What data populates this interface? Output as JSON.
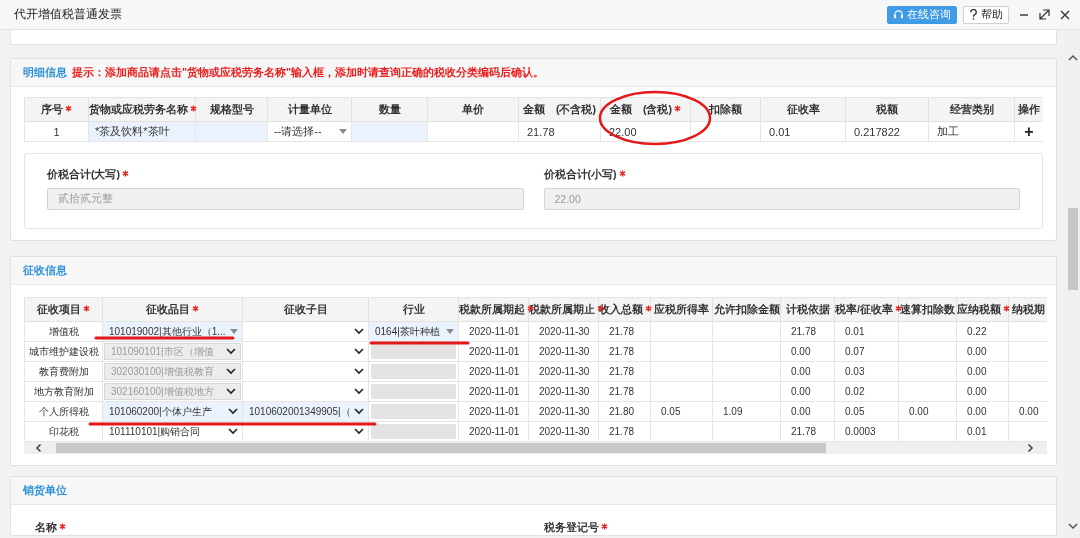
{
  "window": {
    "title": "代开增值税普通发票",
    "buttons": [
      {
        "kind": "consult",
        "label": "在线咨询"
      },
      {
        "kind": "help",
        "label": "帮助"
      }
    ]
  },
  "detail": {
    "title": "明细信息",
    "hint": "提示：添加商品请点击\"货物或应税劳务名称\"输入框，添加时请查询正确的税收分类编码后确认。",
    "table": {
      "columns": [
        {
          "label": "序号",
          "required": true
        },
        {
          "label": "货物或应税劳务名称",
          "required": true
        },
        {
          "label": "规格型号",
          "required": false
        },
        {
          "label": "计量单位",
          "required": false
        },
        {
          "label": "数量",
          "required": false
        },
        {
          "label": "单价",
          "required": false
        },
        {
          "label": "金额　(不含税)",
          "required": false
        },
        {
          "label": "金额　(含税)",
          "required": true
        },
        {
          "label": "扣除额",
          "required": false
        },
        {
          "label": "征收率",
          "required": false
        },
        {
          "label": "税额",
          "required": false
        },
        {
          "label": "经营类别",
          "required": false
        },
        {
          "label": "操作",
          "required": false
        }
      ],
      "rows": [
        {
          "cells": [
            {
              "kind": "text",
              "value": "1"
            },
            {
              "kind": "input",
              "value": "*茶及饮料*茶叶",
              "highlighted": true,
              "disabled": false
            },
            {
              "kind": "input",
              "highlighted": true,
              "disabled": false
            },
            {
              "kind": "combo",
              "value": "--请选择--",
              "highlighted": false,
              "disabled": false
            },
            {
              "kind": "input",
              "highlighted": true,
              "disabled": false
            },
            {
              "kind": "text"
            },
            {
              "kind": "text",
              "value": "21.78"
            },
            {
              "kind": "text",
              "value": "22.00"
            },
            {
              "kind": "text"
            },
            {
              "kind": "text",
              "value": "0.01"
            },
            {
              "kind": "text",
              "value": "0.217822"
            },
            {
              "kind": "text",
              "value": "加工"
            },
            {
              "kind": "action",
              "value": "+"
            }
          ]
        }
      ]
    },
    "totals": [
      {
        "label": "价税合计(大写)",
        "required": true,
        "value": "贰拾贰元整"
      },
      {
        "label": "价税合计(小写)",
        "required": true,
        "value": "22.00"
      }
    ]
  },
  "levy": {
    "title": "征收信息",
    "table": {
      "columns": [
        {
          "label": "征收项目",
          "required": true
        },
        {
          "label": "征收品目",
          "required": true
        },
        {
          "label": "征收子目",
          "required": false
        },
        {
          "label": "行业",
          "required": false
        },
        {
          "label": "税款所属期起",
          "required": true
        },
        {
          "label": "税款所属期止",
          "required": true
        },
        {
          "label": "收入总额",
          "required": true
        },
        {
          "label": "应税所得率",
          "required": false
        },
        {
          "label": "允许扣除金额",
          "required": false
        },
        {
          "label": "计税依据",
          "required": false
        },
        {
          "label": "税率/征收率",
          "required": true
        },
        {
          "label": "速算扣除数",
          "required": false
        },
        {
          "label": "应纳税额",
          "required": true
        },
        {
          "label": "纳税期",
          "required": false
        }
      ],
      "rows": [
        {
          "cells": [
            {
              "kind": "text",
              "value": "增值税"
            },
            {
              "kind": "combo",
              "value": "101019002|其他行业（1...",
              "highlighted": true,
              "disabled": false
            },
            {
              "kind": "select",
              "highlighted": false,
              "disabled": false
            },
            {
              "kind": "combo",
              "value": "0164|茶叶种植",
              "highlighted": true,
              "disabled": false
            },
            {
              "kind": "text",
              "value": "2020-11-01"
            },
            {
              "kind": "text",
              "value": "2020-11-30"
            },
            {
              "kind": "text",
              "value": "21.78"
            },
            {
              "kind": "text"
            },
            {
              "kind": "text"
            },
            {
              "kind": "text",
              "value": "21.78"
            },
            {
              "kind": "text",
              "value": "0.01"
            },
            {
              "kind": "text"
            },
            {
              "kind": "text",
              "value": "0.22"
            },
            {
              "kind": "text"
            }
          ]
        },
        {
          "cells": [
            {
              "kind": "text",
              "value": "城市维护建设税"
            },
            {
              "kind": "select",
              "value": "101090101|市区（增值",
              "highlighted": false,
              "disabled": true
            },
            {
              "kind": "select",
              "highlighted": false,
              "disabled": false
            },
            {
              "kind": "combo",
              "highlighted": false,
              "disabled": true
            },
            {
              "kind": "text",
              "value": "2020-11-01"
            },
            {
              "kind": "text",
              "value": "2020-11-30"
            },
            {
              "kind": "text",
              "value": "21.78"
            },
            {
              "kind": "text"
            },
            {
              "kind": "text"
            },
            {
              "kind": "text",
              "value": "0.00"
            },
            {
              "kind": "text",
              "value": "0.07"
            },
            {
              "kind": "text"
            },
            {
              "kind": "text",
              "value": "0.00"
            },
            {
              "kind": "text"
            }
          ]
        },
        {
          "cells": [
            {
              "kind": "text",
              "value": "教育费附加"
            },
            {
              "kind": "select",
              "value": "302030100|增值税教育",
              "highlighted": false,
              "disabled": true
            },
            {
              "kind": "select",
              "highlighted": false,
              "disabled": false
            },
            {
              "kind": "combo",
              "highlighted": false,
              "disabled": true
            },
            {
              "kind": "text",
              "value": "2020-11-01"
            },
            {
              "kind": "text",
              "value": "2020-11-30"
            },
            {
              "kind": "text",
              "value": "21.78"
            },
            {
              "kind": "text"
            },
            {
              "kind": "text"
            },
            {
              "kind": "text",
              "value": "0.00"
            },
            {
              "kind": "text",
              "value": "0.03"
            },
            {
              "kind": "text"
            },
            {
              "kind": "text",
              "value": "0.00"
            },
            {
              "kind": "text"
            }
          ]
        },
        {
          "cells": [
            {
              "kind": "text",
              "value": "地方教育附加"
            },
            {
              "kind": "select",
              "value": "302160100|增值税地方",
              "highlighted": false,
              "disabled": true
            },
            {
              "kind": "select",
              "highlighted": false,
              "disabled": false
            },
            {
              "kind": "combo",
              "highlighted": false,
              "disabled": true
            },
            {
              "kind": "text",
              "value": "2020-11-01"
            },
            {
              "kind": "text",
              "value": "2020-11-30"
            },
            {
              "kind": "text",
              "value": "21.78"
            },
            {
              "kind": "text"
            },
            {
              "kind": "text"
            },
            {
              "kind": "text",
              "value": "0.00"
            },
            {
              "kind": "text",
              "value": "0.02"
            },
            {
              "kind": "text"
            },
            {
              "kind": "text",
              "value": "0.00"
            },
            {
              "kind": "text"
            }
          ]
        },
        {
          "cells": [
            {
              "kind": "text",
              "value": "个人所得税"
            },
            {
              "kind": "select",
              "value": "101060200|个体户生产",
              "highlighted": true,
              "disabled": false
            },
            {
              "kind": "select",
              "value": "1010602001349905|（",
              "highlighted": true,
              "disabled": false
            },
            {
              "kind": "combo",
              "highlighted": false,
              "disabled": true
            },
            {
              "kind": "text",
              "value": "2020-11-01"
            },
            {
              "kind": "text",
              "value": "2020-11-30"
            },
            {
              "kind": "text",
              "value": "21.80"
            },
            {
              "kind": "text",
              "value": "0.05"
            },
            {
              "kind": "text",
              "value": "1.09"
            },
            {
              "kind": "text",
              "value": "0.00"
            },
            {
              "kind": "text",
              "value": "0.05"
            },
            {
              "kind": "text",
              "value": "0.00"
            },
            {
              "kind": "text",
              "value": "0.00"
            },
            {
              "kind": "text",
              "value": "0.00"
            }
          ]
        },
        {
          "cells": [
            {
              "kind": "text",
              "value": "印花税"
            },
            {
              "kind": "select",
              "value": "101110101|购销合同",
              "highlighted": false,
              "disabled": false
            },
            {
              "kind": "select",
              "highlighted": false,
              "disabled": false
            },
            {
              "kind": "combo",
              "highlighted": false,
              "disabled": true
            },
            {
              "kind": "text",
              "value": "2020-11-01"
            },
            {
              "kind": "text",
              "value": "2020-11-30"
            },
            {
              "kind": "text",
              "value": "21.78"
            },
            {
              "kind": "text"
            },
            {
              "kind": "text"
            },
            {
              "kind": "text",
              "value": "21.78"
            },
            {
              "kind": "text",
              "value": "0.0003"
            },
            {
              "kind": "text"
            },
            {
              "kind": "text",
              "value": "0.01"
            },
            {
              "kind": "text"
            }
          ]
        }
      ]
    }
  },
  "seller": {
    "title": "销货单位",
    "fields": [
      {
        "label": "名称",
        "required": true
      },
      {
        "label": "税务登记号",
        "required": true
      }
    ]
  }
}
